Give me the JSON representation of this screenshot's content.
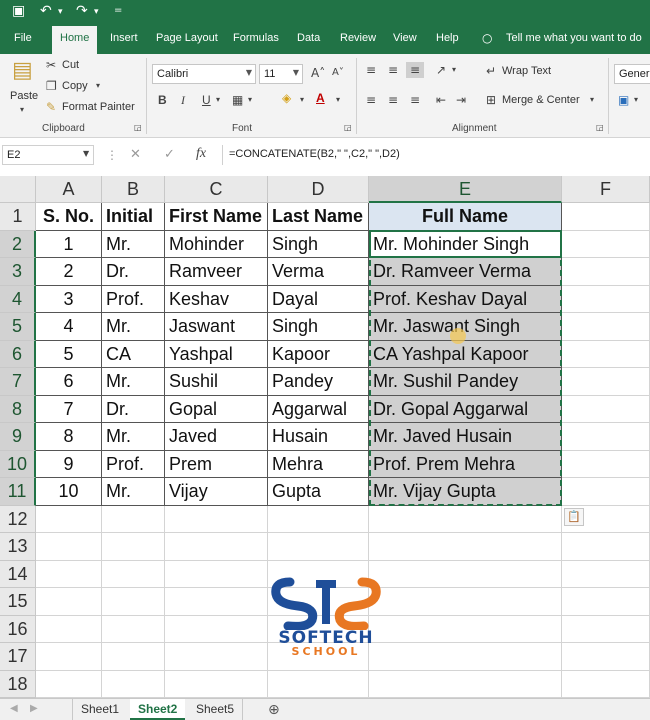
{
  "quick_access": {
    "save_icon": "save-icon",
    "undo_icon": "undo-icon",
    "redo_icon": "redo-icon"
  },
  "tabs": [
    "File",
    "Home",
    "Insert",
    "Page Layout",
    "Formulas",
    "Data",
    "Review",
    "View",
    "Help"
  ],
  "tell_me": "Tell me what you want to do",
  "ribbon": {
    "paste_label": "Paste",
    "cut_label": "Cut",
    "copy_label": "Copy",
    "format_painter_label": "Format Painter",
    "clipboard_label": "Clipboard",
    "font_name": "Calibri",
    "font_size": "11",
    "font_label": "Font",
    "bold": "B",
    "italic": "I",
    "underline": "U",
    "wrap_text_label": "Wrap Text",
    "merge_center_label": "Merge & Center",
    "alignment_label": "Alignment",
    "number_format": "Genera"
  },
  "formula_bar": {
    "name_box": "E2",
    "fx": "fx",
    "formula": "=CONCATENATE(B2,\" \",C2,\" \",D2)"
  },
  "columns": [
    "A",
    "B",
    "C",
    "D",
    "E",
    "F"
  ],
  "rows": [
    "1",
    "2",
    "3",
    "4",
    "5",
    "6",
    "7",
    "8",
    "9",
    "10",
    "11",
    "12",
    "13",
    "14",
    "15",
    "16",
    "17",
    "18"
  ],
  "headers": [
    "S. No.",
    "Initial",
    "First Name",
    "Last Name",
    "Full Name"
  ],
  "table": [
    [
      "1",
      "Mr.",
      "Mohinder",
      "Singh",
      "Mr. Mohinder Singh"
    ],
    [
      "2",
      "Dr.",
      "Ramveer",
      "Verma",
      "Dr. Ramveer Verma"
    ],
    [
      "3",
      "Prof.",
      "Keshav",
      "Dayal",
      "Prof. Keshav Dayal"
    ],
    [
      "4",
      "Mr.",
      "Jaswant",
      "Singh",
      "Mr. Jaswant Singh"
    ],
    [
      "5",
      "CA",
      "Yashpal",
      "Kapoor",
      "CA Yashpal Kapoor"
    ],
    [
      "6",
      "Mr.",
      "Sushil",
      "Pandey",
      "Mr. Sushil Pandey"
    ],
    [
      "7",
      "Dr.",
      "Gopal",
      "Aggarwal",
      "Dr. Gopal Aggarwal"
    ],
    [
      "8",
      "Mr.",
      "Javed",
      "Husain",
      "Mr. Javed Husain"
    ],
    [
      "9",
      "Prof.",
      "Prem",
      "Mehra",
      "Prof. Prem Mehra"
    ],
    [
      "10",
      "Mr.",
      "Vijay",
      "Gupta",
      "Mr. Vijay Gupta"
    ]
  ],
  "sheets": [
    "Sheet1",
    "Sheet2",
    "Sheet5"
  ],
  "active_sheet": "Sheet2",
  "logo": {
    "line1": "SOFTECH",
    "line2": "SCHOOL"
  },
  "colors": {
    "excel_green": "#217346",
    "selection_gray": "#d0d0d0",
    "header_fill": "#dbe5f1"
  }
}
